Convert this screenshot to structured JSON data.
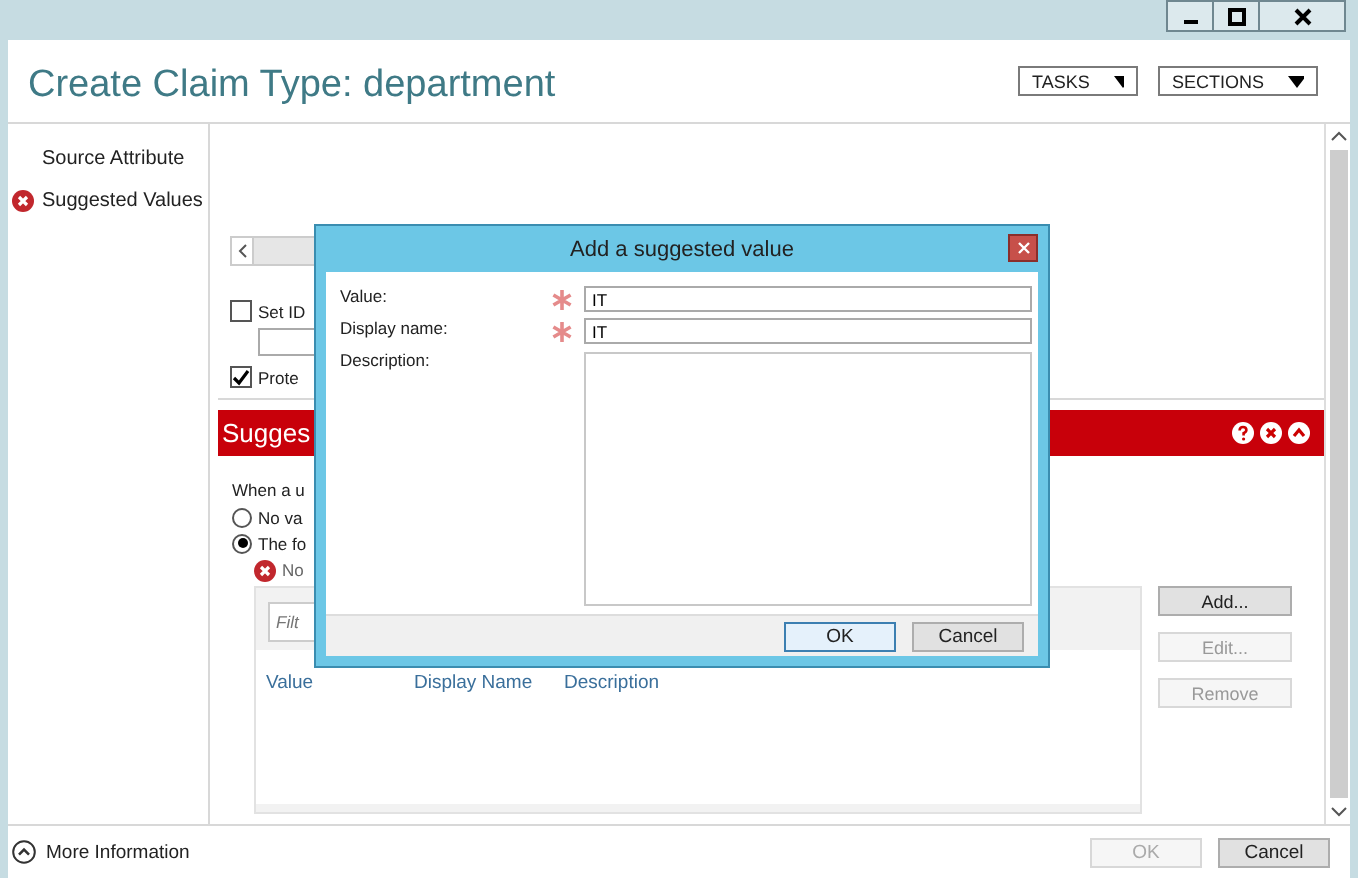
{
  "page": {
    "title": "Create Claim Type: department",
    "menus": [
      {
        "label": "TASKS"
      },
      {
        "label": "SECTIONS"
      }
    ]
  },
  "nav": [
    {
      "label": "Source Attribute",
      "error": false
    },
    {
      "label": "Suggested Values",
      "error": true
    }
  ],
  "source_attribute": {
    "options": [
      {
        "kind": "checkbox",
        "label": "Set ID",
        "checked": false
      },
      {
        "kind": "field"
      },
      {
        "kind": "checkbox",
        "label": "Prote",
        "checked": true
      }
    ]
  },
  "suggested_values": {
    "header": "Sugges",
    "prompt": "When a u",
    "options": [
      {
        "label": "No va",
        "selected": false
      },
      {
        "label": "The fo",
        "selected": true
      }
    ],
    "error": "No",
    "filter": {
      "placeholder": "Filt"
    },
    "columns": [
      "Value",
      "Display Name",
      "Description"
    ],
    "buttons": [
      {
        "label": "Add...",
        "disabled": false
      },
      {
        "label": "Edit...",
        "disabled": true
      },
      {
        "label": "Remove",
        "disabled": true
      }
    ]
  },
  "dialog": {
    "title": "Add a suggested value",
    "fields": [
      {
        "kind": "line",
        "label": "Value:",
        "required": true,
        "value": "IT"
      },
      {
        "kind": "line",
        "label": "Display name:",
        "required": true,
        "value": "IT"
      },
      {
        "kind": "area",
        "label": "Description:",
        "required": false
      }
    ],
    "buttons": [
      {
        "label": "OK",
        "default": true
      },
      {
        "label": "Cancel",
        "default": false
      }
    ]
  },
  "footer": {
    "more": "More Information",
    "buttons": [
      {
        "label": "OK",
        "disabled": true
      },
      {
        "label": "Cancel",
        "disabled": false
      }
    ]
  }
}
